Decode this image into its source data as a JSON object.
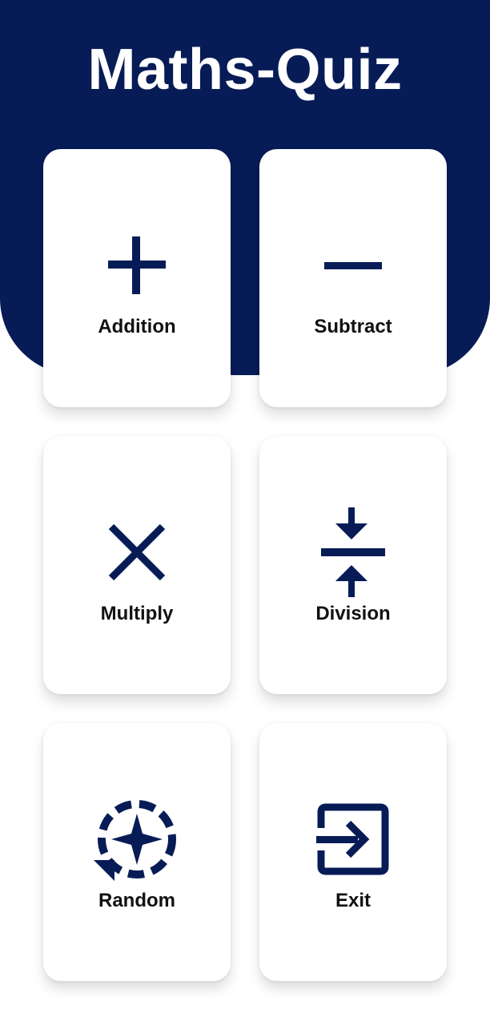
{
  "app": {
    "title": "Maths-Quiz"
  },
  "colors": {
    "header": "#071c56",
    "icon": "#071c56",
    "card": "#ffffff",
    "label": "#111111"
  },
  "cards": [
    {
      "label": "Addition",
      "icon": "plus-icon"
    },
    {
      "label": "Subtract",
      "icon": "minus-icon"
    },
    {
      "label": "Multiply",
      "icon": "multiply-icon"
    },
    {
      "label": "Division",
      "icon": "division-icon"
    },
    {
      "label": "Random",
      "icon": "random-icon"
    },
    {
      "label": "Exit",
      "icon": "exit-icon"
    }
  ]
}
